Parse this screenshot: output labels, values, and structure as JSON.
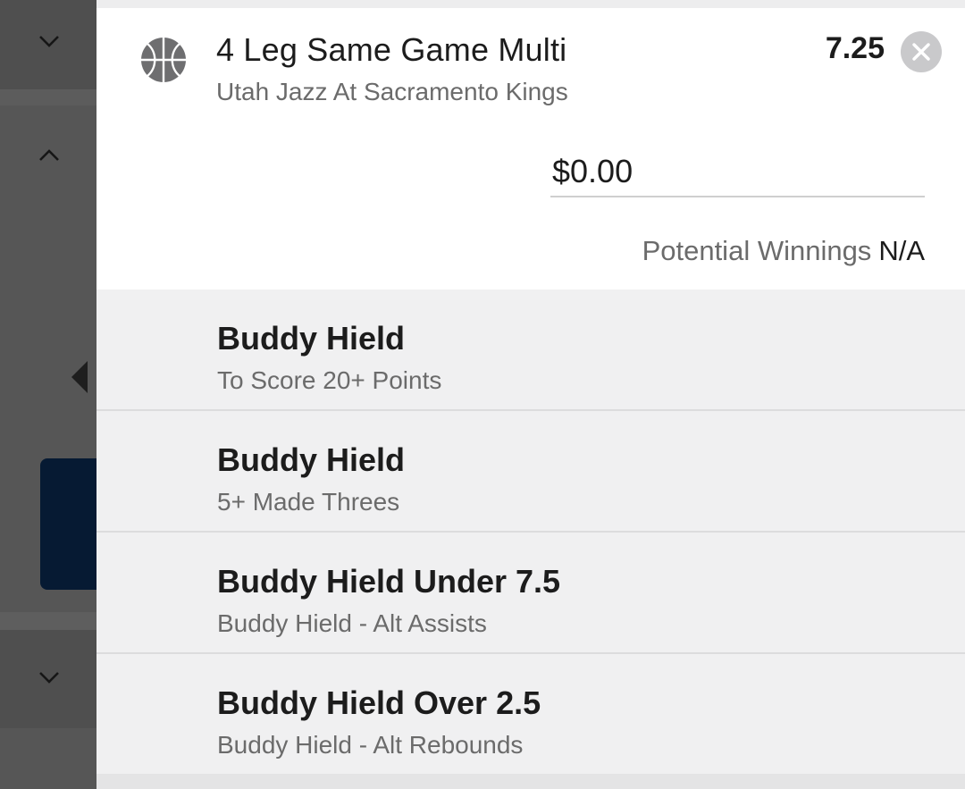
{
  "bet": {
    "title": "4 Leg Same Game Multi",
    "match": "Utah Jazz At Sacramento Kings",
    "odds": "7.25",
    "stake_value": "$0.00",
    "potential_label": "Potential Winnings",
    "potential_value": "N/A",
    "sport_icon": "basketball-icon",
    "close_icon": "close-icon"
  },
  "legs": [
    {
      "title": "Buddy Hield",
      "subtitle": "To Score 20+ Points"
    },
    {
      "title": "Buddy Hield",
      "subtitle": "5+ Made Threes"
    },
    {
      "title": "Buddy Hield Under 7.5",
      "subtitle": "Buddy Hield - Alt Assists"
    },
    {
      "title": "Buddy Hield Over 2.5",
      "subtitle": "Buddy Hield - Alt Rebounds"
    }
  ],
  "colors": {
    "overlay": "#565656",
    "navy": "#061a33",
    "panel_bg": "#f0f0f1",
    "header_bg": "#ffffff",
    "text_primary": "#1c1c1c",
    "text_secondary": "#6b6b6b"
  }
}
